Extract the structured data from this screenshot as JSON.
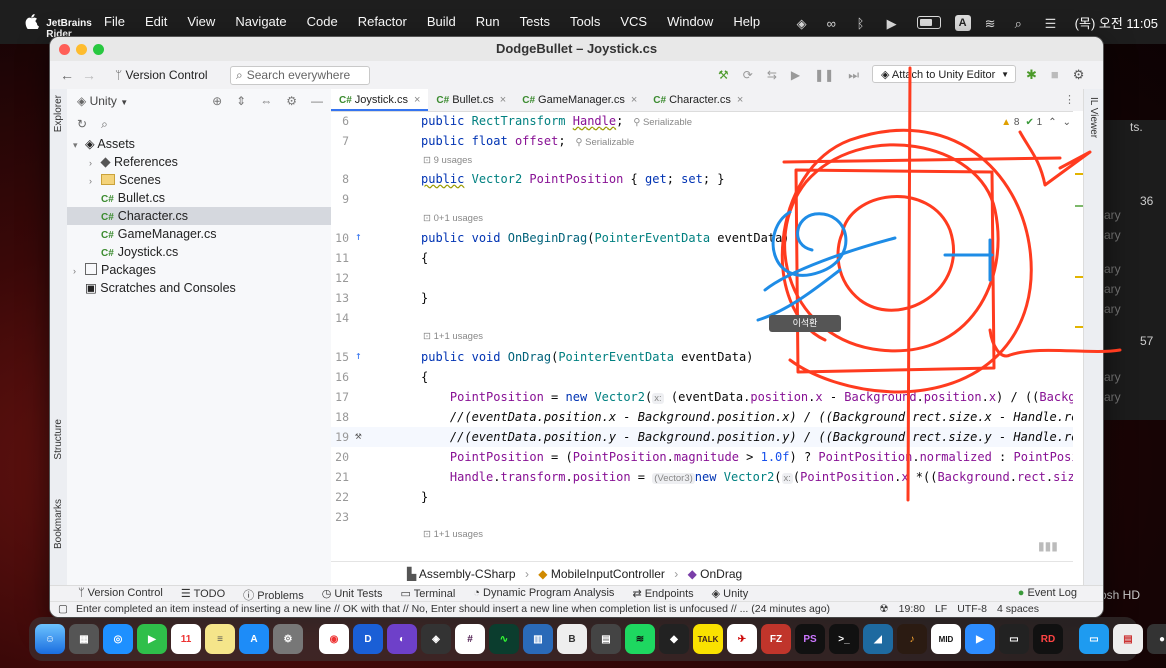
{
  "menubar": {
    "app": "JetBrains Rider",
    "items": [
      "File",
      "Edit",
      "View",
      "Navigate",
      "Code",
      "Refactor",
      "Build",
      "Run",
      "Tests",
      "Tools",
      "VCS",
      "Window",
      "Help"
    ],
    "input_label": "A",
    "datetime": "(목) 오전 11:05"
  },
  "window": {
    "title": "DodgeBullet – Joystick.cs",
    "toolbar": {
      "version_control": "Version Control",
      "search_placeholder": "Search everywhere",
      "run_config": "Attach to Unity Editor"
    }
  },
  "explorer": {
    "tab_label": "Explorer",
    "view": "Unity",
    "tree": [
      {
        "label": "Assets",
        "indent": 0,
        "arrow": "▾",
        "kind": "assets"
      },
      {
        "label": "References",
        "indent": 1,
        "arrow": "›",
        "kind": "ref"
      },
      {
        "label": "Scenes",
        "indent": 1,
        "arrow": "›",
        "kind": "folder"
      },
      {
        "label": "Bullet.cs",
        "indent": 1,
        "arrow": "",
        "kind": "cs"
      },
      {
        "label": "Character.cs",
        "indent": 1,
        "arrow": "",
        "kind": "cs",
        "selected": true
      },
      {
        "label": "GameManager.cs",
        "indent": 1,
        "arrow": "",
        "kind": "cs"
      },
      {
        "label": "Joystick.cs",
        "indent": 1,
        "arrow": "",
        "kind": "cs"
      },
      {
        "label": "Packages",
        "indent": 0,
        "arrow": "›",
        "kind": "pkg"
      },
      {
        "label": "Scratches and Consoles",
        "indent": 0,
        "arrow": "",
        "kind": "scratch"
      }
    ]
  },
  "tabs": [
    {
      "label": "Joystick.cs",
      "active": true
    },
    {
      "label": "Bullet.cs",
      "active": false
    },
    {
      "label": "GameManager.cs",
      "active": false
    },
    {
      "label": "Character.cs",
      "active": false
    }
  ],
  "editor_indicators": {
    "warnings": "8",
    "ok": "1"
  },
  "code": {
    "lines": [
      {
        "n": "6"
      },
      {
        "n": "7"
      },
      {
        "n": "8"
      },
      {
        "n": "9"
      },
      {
        "n": "10"
      },
      {
        "n": "11"
      },
      {
        "n": "12"
      },
      {
        "n": "13"
      },
      {
        "n": "14"
      },
      {
        "n": "15"
      },
      {
        "n": "16"
      },
      {
        "n": "17"
      },
      {
        "n": "18"
      },
      {
        "n": "19"
      },
      {
        "n": "20"
      },
      {
        "n": "21"
      },
      {
        "n": "22"
      },
      {
        "n": "23"
      }
    ],
    "hints": {
      "serializable": "Serializable",
      "usages_9": "9 usages",
      "usages_0_1": "0+1 usages",
      "usages_1_1a": "1+1 usages",
      "usages_1_1b": "1+1 usages",
      "vector3": "(Vector3)",
      "x_hint": "x:"
    }
  },
  "breadcrumbs": {
    "assembly": "Assembly-CSharp",
    "controller": "MobileInputController",
    "method": "OnDrag"
  },
  "side_labels": {
    "structure": "Structure",
    "bookmarks": "Bookmarks",
    "il_viewer": "IL Viewer"
  },
  "bottom_tools": [
    "Version Control",
    "TODO",
    "Problems",
    "Unit Tests",
    "Terminal",
    "Dynamic Program Analysis",
    "Endpoints",
    "Unity"
  ],
  "event_log": "Event Log",
  "status": {
    "message": "Enter completed an item instead of inserting a new line // OK with that // No, Enter should insert a new line when completion list is unfocused // ... (24 minutes ago)",
    "position": "19:80",
    "line_ending": "LF",
    "encoding": "UTF-8",
    "indent": "4 spaces"
  },
  "annotation_tooltip": "이석환",
  "background_text": [
    "ts.",
    "36",
    "ary",
    "ary",
    "ary",
    "ary",
    "ary",
    "57",
    "ary",
    "ary",
    "osh HD"
  ],
  "dock": {
    "calendar_day": "11",
    "badge_talk": "TALK"
  }
}
